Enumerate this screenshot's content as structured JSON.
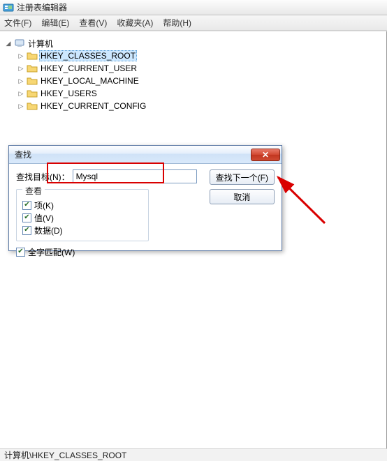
{
  "window": {
    "title": "注册表编辑器"
  },
  "menu": {
    "file": "文件(F)",
    "edit": "编辑(E)",
    "view": "查看(V)",
    "favorites": "收藏夹(A)",
    "help": "帮助(H)"
  },
  "tree": {
    "root": "计算机",
    "items": [
      "HKEY_CLASSES_ROOT",
      "HKEY_CURRENT_USER",
      "HKEY_LOCAL_MACHINE",
      "HKEY_USERS",
      "HKEY_CURRENT_CONFIG"
    ]
  },
  "dialog": {
    "title": "查找",
    "find_label": "查找目标(N)：",
    "find_value": "Mysql",
    "look_legend": "查看",
    "check_keys": "项(K)",
    "check_values": "值(V)",
    "check_data": "数据(D)",
    "check_whole": "全字匹配(W)",
    "btn_find_next": "查找下一个(F)",
    "btn_cancel": "取消"
  },
  "status": {
    "path": "计算机\\HKEY_CLASSES_ROOT"
  }
}
